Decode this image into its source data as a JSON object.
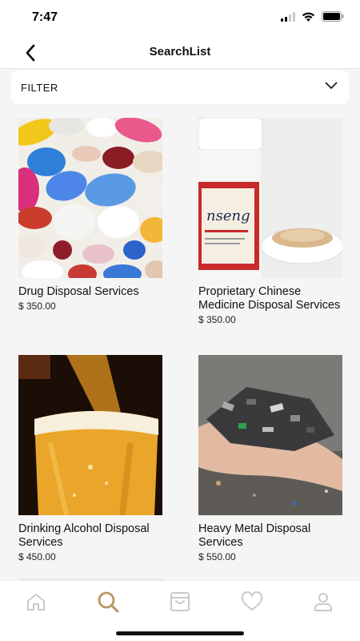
{
  "status_bar": {
    "time": "7:47"
  },
  "nav": {
    "title": "SearchList"
  },
  "filter": {
    "label": "FILTER"
  },
  "products": [
    {
      "name": "Drug Disposal Services",
      "price": "$ 350.00"
    },
    {
      "name": "Proprietary Chinese Medicine Disposal Services",
      "price": "$ 350.00"
    },
    {
      "name": "Drinking Alcohol Disposal Services",
      "price": "$ 450.00"
    },
    {
      "name": "Heavy Metal Disposal Services",
      "price": "$ 550.00"
    }
  ],
  "tab_bar": {
    "items": [
      {
        "icon": "home-icon",
        "active": false
      },
      {
        "icon": "search-icon",
        "active": true
      },
      {
        "icon": "shopping-bag-icon",
        "active": false
      },
      {
        "icon": "heart-icon",
        "active": false
      },
      {
        "icon": "profile-icon",
        "active": false
      }
    ]
  },
  "colors": {
    "active_tab": "#b89565",
    "inactive_tab": "#c9c9c9",
    "background": "#f5f5f5"
  }
}
